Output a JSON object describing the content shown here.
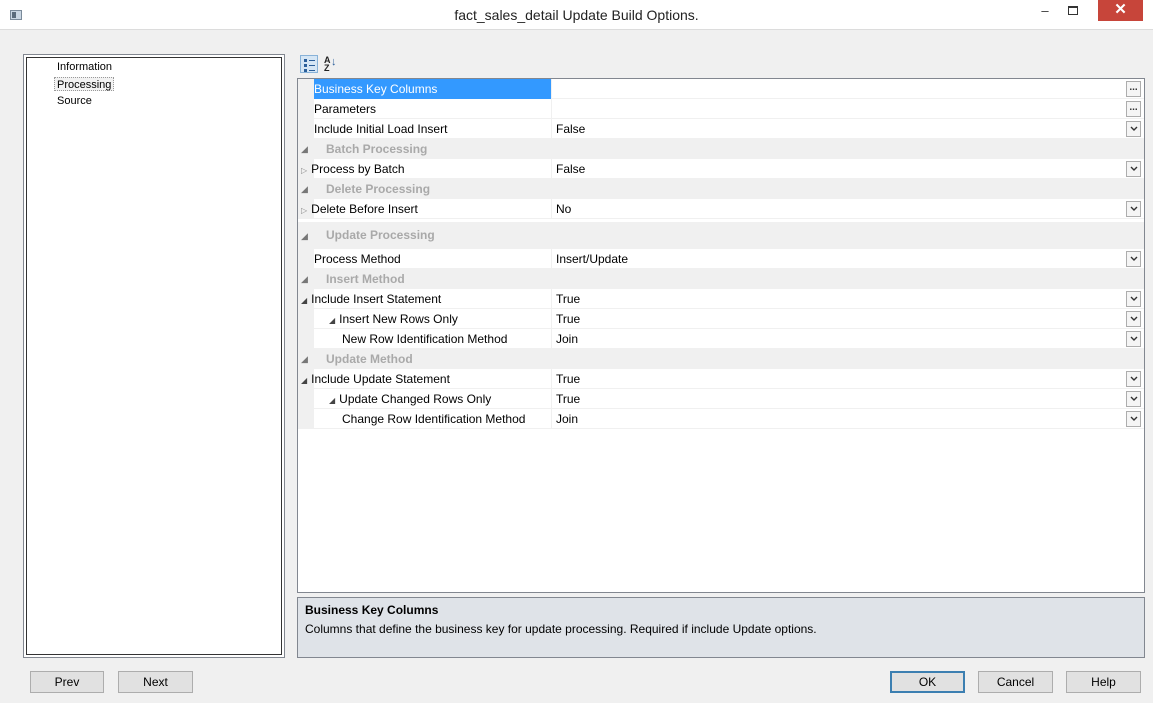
{
  "window": {
    "title": "fact_sales_detail Update Build Options.",
    "minimize_glyph": "–",
    "close_glyph": "✕"
  },
  "nav": {
    "items": [
      {
        "label": "Information",
        "selected": false
      },
      {
        "label": "Processing",
        "selected": true
      },
      {
        "label": "Source",
        "selected": false
      }
    ]
  },
  "toolbar": {
    "categorized_icon": "categorized-icon",
    "alphabetical_icon": "sort-az-icon",
    "az_top": "A",
    "az_bottom": "Z"
  },
  "properties": {
    "rows": [
      {
        "name": "Business Key Columns",
        "value": "",
        "kind": "ellipsis",
        "selected": true
      },
      {
        "name": "Parameters",
        "value": "",
        "kind": "ellipsis"
      },
      {
        "name": "Include Initial Load Insert",
        "value": "False",
        "kind": "dropdown"
      },
      {
        "name": "Batch Processing",
        "kind": "category"
      },
      {
        "name": "Process by Batch",
        "value": "False",
        "kind": "dropdown",
        "expander": "▷"
      },
      {
        "name": "Delete Processing",
        "kind": "category"
      },
      {
        "name": "Delete Before Insert",
        "value": "No",
        "kind": "dropdown",
        "expander": "▷"
      },
      {
        "name": "Update Processing",
        "kind": "category"
      },
      {
        "name": "Process Method",
        "value": "Insert/Update",
        "kind": "dropdown"
      },
      {
        "name": "Insert Method",
        "kind": "category"
      },
      {
        "name": "Include Insert Statement",
        "value": "True",
        "kind": "dropdown",
        "expander": "◢"
      },
      {
        "name": "Insert New Rows Only",
        "value": "True",
        "kind": "dropdown",
        "expander": "◢",
        "level": 1
      },
      {
        "name": "New Row Identification Method",
        "value": "Join",
        "kind": "dropdown",
        "level": 2
      },
      {
        "name": "Update Method",
        "kind": "category"
      },
      {
        "name": "Include Update Statement",
        "value": "True",
        "kind": "dropdown",
        "expander": "◢"
      },
      {
        "name": "Update Changed Rows Only",
        "value": "True",
        "kind": "dropdown",
        "expander": "◢",
        "level": 1
      },
      {
        "name": "Change Row Identification Method",
        "value": "Join",
        "kind": "dropdown",
        "level": 2
      }
    ],
    "category_glyph": "◢",
    "ellipsis_glyph": "..."
  },
  "help": {
    "title": "Business Key Columns",
    "text": "Columns that define the business key for update processing. Required if include Update options."
  },
  "buttons": {
    "prev": "Prev",
    "next": "Next",
    "ok": "OK",
    "cancel": "Cancel",
    "help": "Help"
  }
}
